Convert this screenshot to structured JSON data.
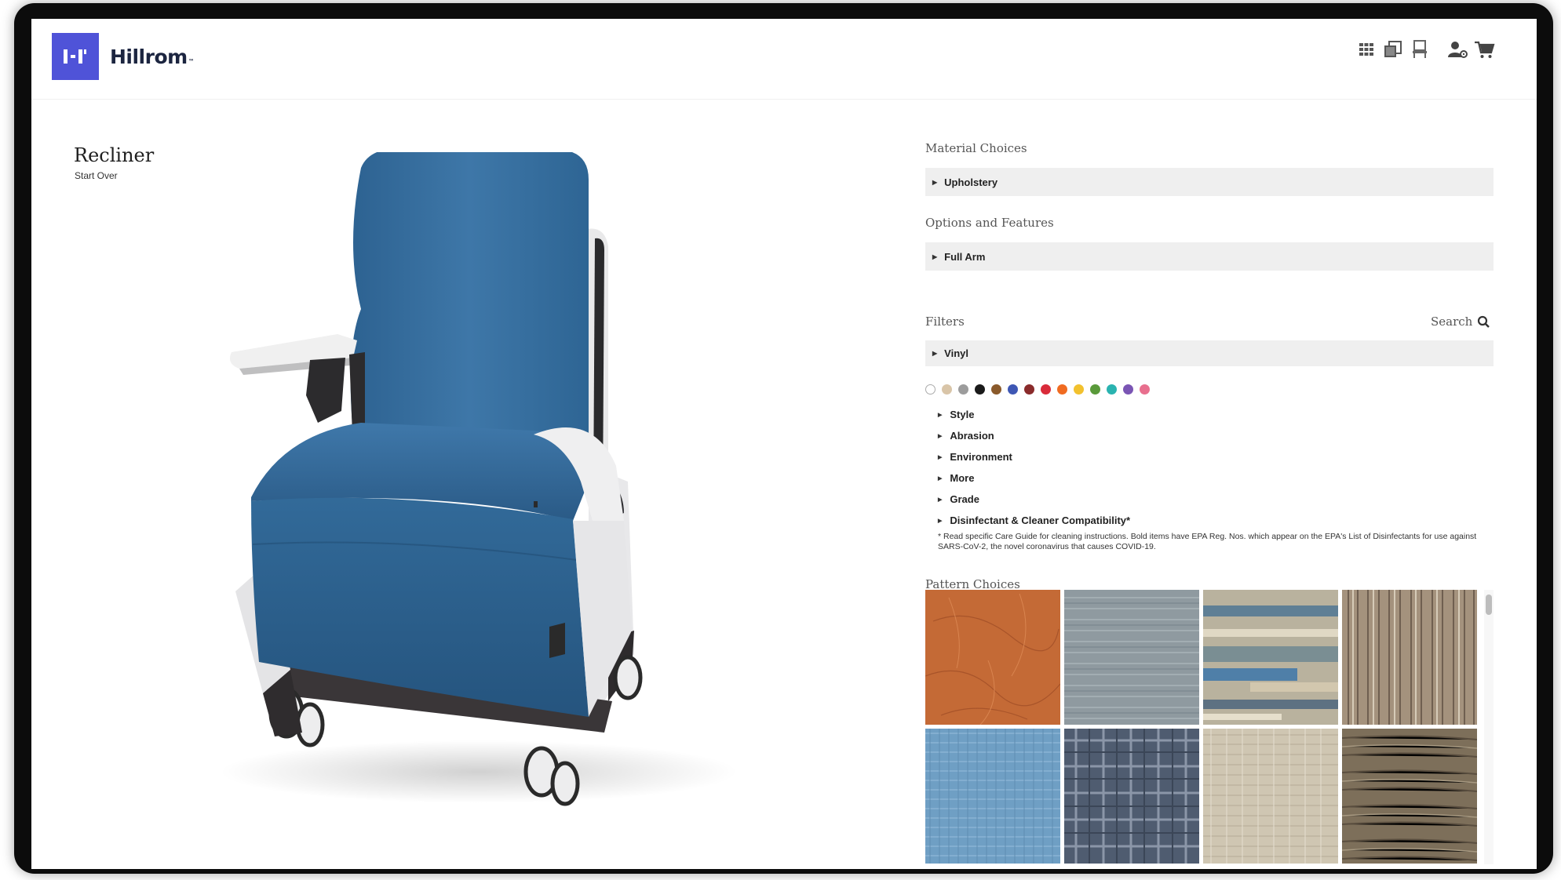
{
  "header": {
    "logo_glyph": "I·I'",
    "brand": "Hillrom",
    "brand_tm": "™",
    "icons": [
      "grid-icon",
      "compare-icon",
      "chair-icon",
      "account-icon",
      "cart-icon"
    ]
  },
  "product": {
    "title": "Recliner",
    "start_over": "Start Over"
  },
  "panel": {
    "material": {
      "label": "Material Choices",
      "bar": "Upholstery"
    },
    "options": {
      "label": "Options and Features",
      "bar": "Full Arm"
    },
    "filters": {
      "label": "Filters",
      "search_label": "Search",
      "bar": "Vinyl",
      "swatches": [
        "#ffffff",
        "#d9c5a8",
        "#9c9c9c",
        "#1a1a1a",
        "#8a5a2b",
        "#3e57b4",
        "#8a2b2b",
        "#d92b3a",
        "#f06b21",
        "#f2c12e",
        "#5a9a3a",
        "#2ab3b0",
        "#7a55b4",
        "#e86f8e"
      ],
      "items": [
        {
          "label": "Style"
        },
        {
          "label": "Abrasion"
        },
        {
          "label": "Environment"
        },
        {
          "label": "More"
        },
        {
          "label": "Grade"
        },
        {
          "label": "Disinfectant & Cleaner Compatibility*"
        }
      ],
      "footnote": "* Read specific Care Guide for cleaning instructions. Bold items have EPA Reg. Nos. which appear on the EPA's List of Disinfectants for use against SARS-CoV-2, the novel coronavirus that causes COVID-19."
    },
    "patterns": {
      "label": "Pattern Choices",
      "items": [
        {
          "name": "orange-leather",
          "color": "#c46a36"
        },
        {
          "name": "gray-weave",
          "color": "#8f9aa0"
        },
        {
          "name": "blue-beige-abstract",
          "color": "#9aa39a"
        },
        {
          "name": "striped-taupe",
          "color": "#9a8a78"
        },
        {
          "name": "light-blue-weave",
          "color": "#6f9fc4"
        },
        {
          "name": "navy-plaid",
          "color": "#4f5c70"
        },
        {
          "name": "cream-tweed",
          "color": "#cfc6b2"
        },
        {
          "name": "brown-striation",
          "color": "#7d6f5a"
        }
      ]
    }
  }
}
